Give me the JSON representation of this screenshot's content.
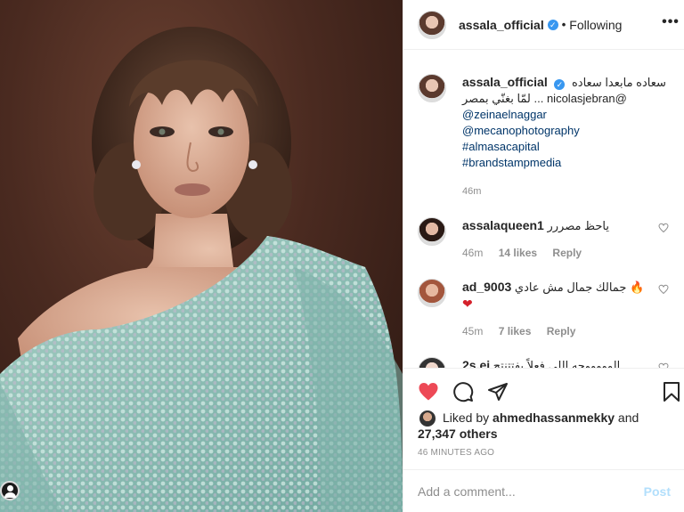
{
  "colors": {
    "accent": "#3897f0",
    "link": "#003569",
    "muted": "#8e8e8e",
    "liked": "#ed4956"
  },
  "header": {
    "username": "assala_official",
    "verified_icon": "verified-badge-icon",
    "separator": "•",
    "follow_state": "Following",
    "more_icon": "more-options-icon",
    "more_label": "•••"
  },
  "caption": {
    "username": "assala_official",
    "text": "سعاده مابعدا سعاده",
    "line2": "@nicolasjebran ... لمّا بغنّي بمصر",
    "tags": [
      "@zeinaelnaggar",
      "@mecanophotography",
      "#almasacapital",
      "#brandstampmedia"
    ],
    "time": "46m"
  },
  "comments": [
    {
      "username": "assalaqueen1",
      "text": "ياحظ مصررر",
      "emoji": "",
      "time": "46m",
      "likes": "14 likes",
      "reply": "Reply"
    },
    {
      "username": "ad_9003",
      "text": "جمالك جمال مش عادي",
      "emoji": "🔥",
      "emoji2": "❤",
      "time": "45m",
      "likes": "7 likes",
      "reply": "Reply"
    },
    {
      "username": "2s.ei",
      "text": "الوووووحه اللي فعلاً بفتتنتح",
      "emoji": "",
      "time": "",
      "likes": "",
      "reply": ""
    }
  ],
  "actions": {
    "like_icon": "heart-filled-icon",
    "comment_icon": "comment-icon",
    "share_icon": "share-icon",
    "save_icon": "bookmark-icon"
  },
  "likes": {
    "prefix": "Liked by",
    "user": "ahmedhassanmekky",
    "and": "and",
    "others": "27,347 others"
  },
  "timestamp": "46 MINUTES AGO",
  "add_comment": {
    "placeholder": "Add a comment...",
    "post_label": "Post"
  }
}
